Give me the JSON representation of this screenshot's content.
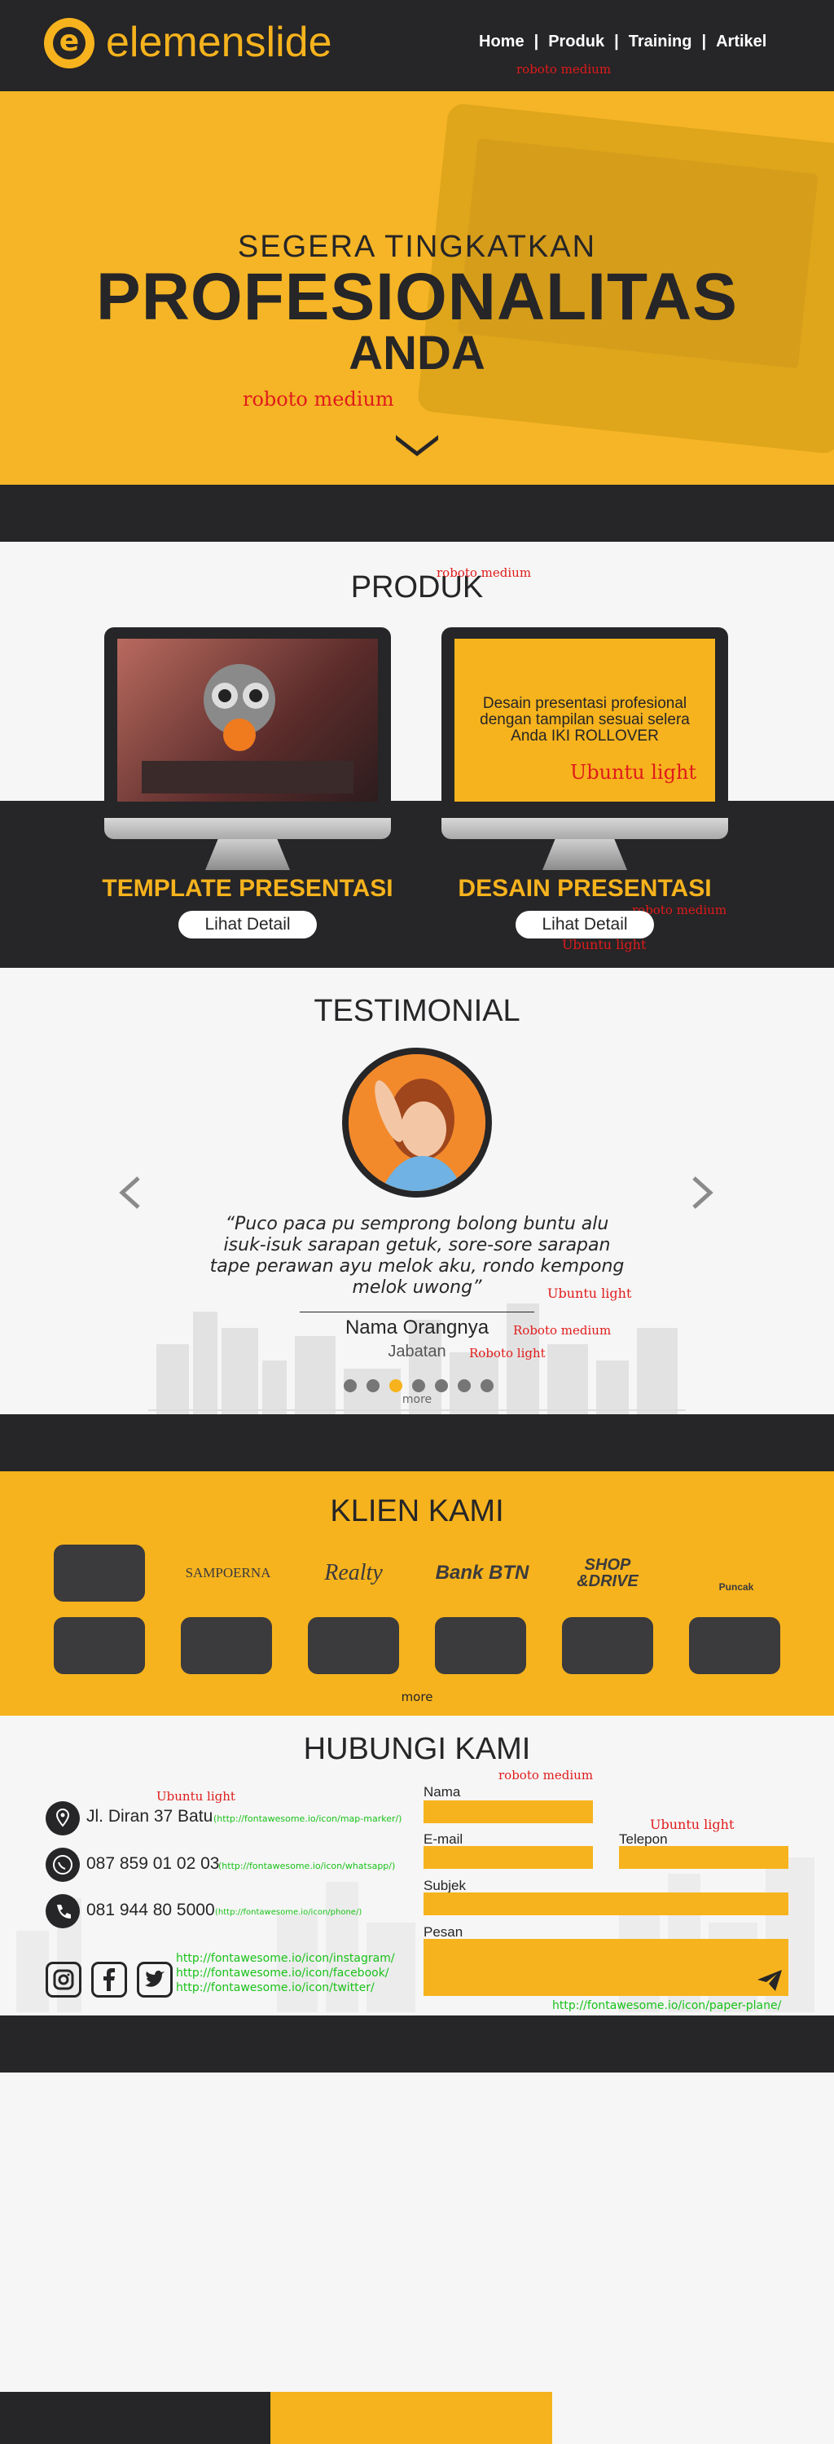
{
  "brand": {
    "logo_letter": "e",
    "name": "elemenslide"
  },
  "nav": {
    "items": [
      "Home",
      "Produk",
      "Training",
      "Artikel"
    ],
    "separator": "|"
  },
  "hero": {
    "line1": "SEGERA TINGKATKAN",
    "line2": "PROFESIONALITAS",
    "line3": "ANDA"
  },
  "produk": {
    "title": "PRODUK",
    "items": [
      {
        "title": "TEMPLATE PRESENTASI",
        "button": "Lihat Detail",
        "overlay": ""
      },
      {
        "title": "DESAIN PRESENTASI",
        "button": "Lihat Detail",
        "overlay": "Desain presentasi profesional dengan tampilan sesuai selera Anda IKI ROLLOVER"
      }
    ]
  },
  "testimonial": {
    "title": "TESTIMONIAL",
    "quote": "“Puco paca pu semprong bolong buntu alu isuk-isuk sarapan getuk, sore-sore sarapan tape perawan ayu melok aku, rondo kempong melok uwong”",
    "name": "Nama Orangnya",
    "role": "Jabatan",
    "more": "more",
    "dots_total": 7,
    "dot_active": 2
  },
  "klien": {
    "title": "KLIEN KAMI",
    "logos": [
      "SAMPOERNA",
      "Realty",
      "Bank BTN",
      "SHOP &DRIVE",
      "Puncak"
    ],
    "more": "more"
  },
  "hubungi": {
    "title": "HUBUNGI KAMI",
    "address": "Jl. Diran 37 Batu",
    "whatsapp": "087 859 01 02 03",
    "phone": "081 944 80 5000",
    "fields": {
      "nama": "Nama",
      "email": "E-mail",
      "telepon": "Telepon",
      "subjek": "Subjek",
      "pesan": "Pesan"
    }
  },
  "annotations": {
    "roboto_medium": "roboto medium",
    "ubuntu_light": "Ubuntu light",
    "roboto_light": "Roboto light",
    "roboto_medium_cap": "Roboto medium",
    "link_map": "(http://fontawesome.io/icon/map-marker/)",
    "link_wa": "(http://fontawesome.io/icon/whatsapp/)",
    "link_phone": "(http://fontawesome.io/icon/phone/)",
    "link_instagram": "http://fontawesome.io/icon/instagram/",
    "link_facebook": "http://fontawesome.io/icon/facebook/",
    "link_twitter": "http://fontawesome.io/icon/twitter/",
    "link_plane": "http://fontawesome.io/icon/paper-plane/"
  },
  "colors": {
    "dark": "#262527",
    "yellow": "#f6b31d",
    "bg": "#f6f6f6",
    "annotation_red": "#e01b1b",
    "annotation_green": "#19c219"
  }
}
